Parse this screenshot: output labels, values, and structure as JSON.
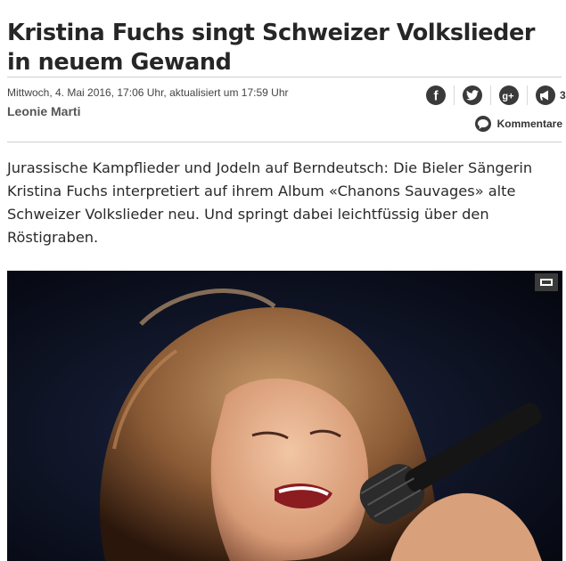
{
  "article": {
    "title": "Kristina Fuchs singt Schweizer Volkslieder in neuem Gewand",
    "date": "Mittwoch, 4. Mai 2016, 17:06 Uhr, aktualisiert um 17:59 Uhr",
    "author": "Leonie Marti",
    "lead": "Jurassische Kampflieder und Jodeln auf Berndeutsch: Die Bieler Sängerin Kristina Fuchs interpretiert auf ihrem Album «Chanons Sauvages» alte Schweizer Volkslieder neu. Und springt dabei leichtfüssig über den Röstigraben."
  },
  "share": {
    "icons": [
      "facebook-icon",
      "twitter-icon",
      "google-plus-icon",
      "megaphone-icon"
    ],
    "count": "3"
  },
  "comments": {
    "label": "Kommentare",
    "icon": "comment-bubble-icon"
  },
  "photo": {
    "expand_icon": "expand-icon"
  }
}
